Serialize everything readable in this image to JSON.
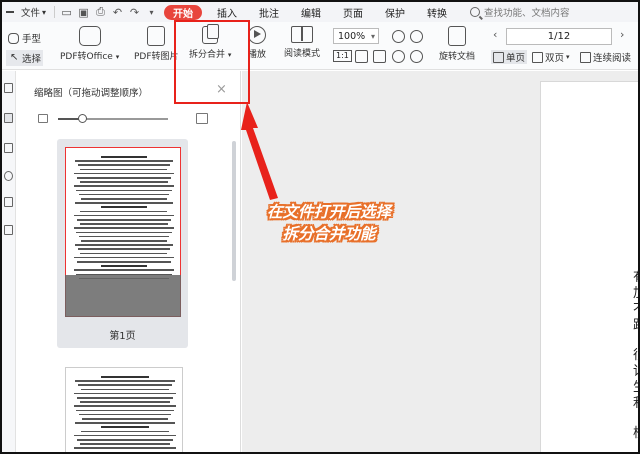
{
  "menubar": {
    "file_label": "文件",
    "file_chevron": "▾",
    "quick_icons": [
      "open-folder-icon",
      "save-icon",
      "print-icon",
      "undo-icon",
      "redo-icon",
      "more-chevron-icon"
    ],
    "quick_glyphs": [
      "▭",
      "▣",
      "⎙",
      "↶",
      "↷",
      "▾"
    ],
    "tabs": [
      {
        "label": "开始",
        "active": true
      },
      {
        "label": "插入"
      },
      {
        "label": "批注"
      },
      {
        "label": "编辑"
      },
      {
        "label": "页面"
      },
      {
        "label": "保护"
      },
      {
        "label": "转换"
      }
    ],
    "search_placeholder": "查找功能、文档内容"
  },
  "ribbon": {
    "hand_tool": "手型",
    "select_tool": "选择",
    "pdf_to_office": "PDF转Office",
    "pdf_to_image": "PDF转图片",
    "split_merge": "拆分合并",
    "play": "播放",
    "read_mode": "阅读模式",
    "zoom": "100%",
    "actual_size": "1:1",
    "rotate_doc": "旋转文档",
    "page_indicator": "1/12",
    "prev_page": "‹",
    "next_page": "›",
    "single_page": "单页",
    "double_page": "双页",
    "continuous": "连续阅读",
    "dropdown_chevron": "▾",
    "accent_color": "#e8453c"
  },
  "thumbnail_panel": {
    "title": "缩略图（可拖动调整顺序）",
    "close": "×",
    "slider_percent": 22,
    "pages": [
      {
        "label": "第1页",
        "selected": true
      },
      {
        "label": "",
        "selected": false
      }
    ]
  },
  "document": {
    "visible_chars": [
      "有",
      "加",
      "不",
      "距",
      "很",
      "讨",
      "生",
      "利",
      "核"
    ]
  },
  "annotation": {
    "line1": "在文件打开后选择",
    "line2": "拆分合并功能",
    "highlight_color": "#e8221b",
    "callout_color": "#e8702a"
  }
}
